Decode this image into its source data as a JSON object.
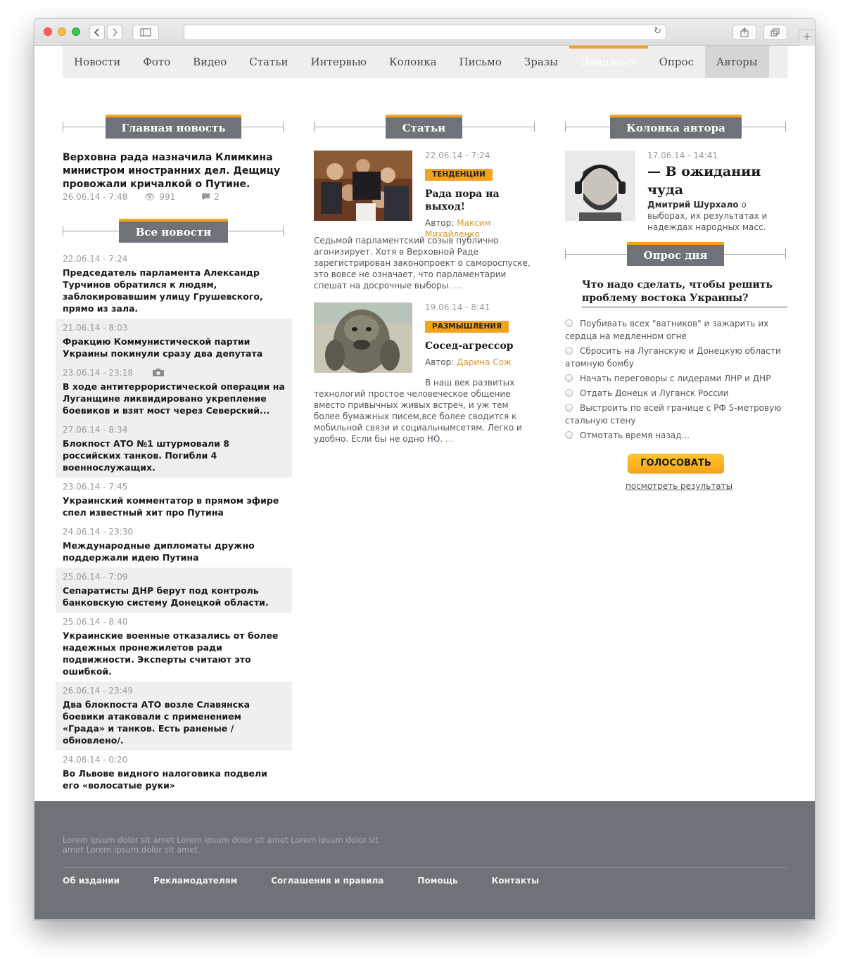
{
  "browser": {
    "back_icon": "chevron-left-icon",
    "forward_icon": "chevron-right-icon",
    "sidebar_icon": "sidebar-icon",
    "reload_icon": "reload-icon",
    "share_icon": "share-icon",
    "tabs_icon": "tabs-icon",
    "newtab_icon": "plus-icon",
    "url": ""
  },
  "nav": {
    "items": [
      "Новости",
      "Фото",
      "Видео",
      "Статьи",
      "Интервью",
      "Колонка",
      "Письмо",
      "Зразы",
      "Дайджест",
      "Опрос",
      "Авторы"
    ],
    "active": "Дайджест",
    "accent": "#f5a31a"
  },
  "main_news": {
    "header": "Главная новость",
    "title": "Верховна рада назначила Климкина министром иностранних дел. Дещицу провожали кричалкой о Путине.",
    "date": "26.06.14 - 7:48",
    "views": "991",
    "comments": "2"
  },
  "all_news": {
    "header": "Все новости",
    "items": [
      {
        "date": "22.06.14 - 7:24",
        "title": "Председатель парламента Александр Турчинов обратился к людям, заблокировавшим улицу Грушевского, прямо из зала."
      },
      {
        "date": "21.06.14 - 8:03",
        "title": "Фракцию Коммунистической партии Украины покинули сразу два депутата"
      },
      {
        "date": "23.06.14 - 23:18",
        "title": "В ходе антитеррористической операции на Луганщине ликвидировано укрепление боевиков и взят мост через Северский..."
      },
      {
        "date": "27.06.14 - 8:34",
        "title": "Блокпост АТО №1 штурмовали 8 российских танков. Погибли 4 военнослужащих."
      },
      {
        "date": "23.06.14 - 7:45",
        "title": "Украинский комментатор в прямом эфире спел известный хит про Путина"
      },
      {
        "date": "24.06.14 - 23:30",
        "title": "Международные дипломаты дружно поддержали идею Путина"
      },
      {
        "date": "25.06.14 - 7:09",
        "title": "Сепаратисты ДНР берут под контроль банковскую систему Донецкой области."
      },
      {
        "date": "25.06.14 - 8:40",
        "title": "Украинские военные отказались от более надежных пронежилетов ради подвижности. Эксперты считают это ошибкой."
      },
      {
        "date": "26.06.14 - 23:49",
        "title": "Два блокпоста АТО возле Славянска боевики атаковали с применением «Града» и танков. Есть раненые /обновлено/."
      },
      {
        "date": "24.06.14 - 0:20",
        "title": "Во Львове видного налоговика подвели его «волосатые руки»"
      }
    ]
  },
  "articles": {
    "header": "Статьи",
    "items": [
      {
        "date": "22.06.14 - 7:24",
        "tag": "ТЕНДЕНЦИИ",
        "title": "Рада пора на выход!",
        "author_label": "Автор:",
        "author": "Максим Михайленко",
        "text": "Седьмой парламентский созыв публично агонизирует. Хотя в Верховной Раде зарегистрирован законопроект о самороспуске, это вовсе не означает, что парламентарии спешат на досрочные выборы.",
        "more": "..."
      },
      {
        "date": "19.06.14 - 8:41",
        "tag": "РАЗМЫШЛЕНИЯ",
        "title": "Сосед-агрессор",
        "author_label": "Автор:",
        "author": "Дарина Сож",
        "text_intro": "В наш век развитых",
        "text": "технологий простое человеческое общение вместо привычных живых встреч, и уж тем более бумажных писем,все более сводится к мобильной связи и социальнымсетям. Легко и удобно. Если бы не одно НО.",
        "more": "..."
      }
    ]
  },
  "column": {
    "header": "Колонка автора",
    "date": "17.06.14 - 14:41",
    "title": "— В ожидании чуда",
    "author": "Дмитрий Шурхало",
    "desc": " о выборах, их результатах и надеждах народных масс."
  },
  "poll": {
    "header": "Опрос дня",
    "question": "Что надо сделать, чтобы решить проблему востока Украины?",
    "options": [
      "Поубивать всех \"ватников\" и зажарить их сердца на медленном огне",
      "Сбросить на Луганскую и Донецкую области атомную бомбу",
      "Начать переговоры с лидерами ЛНР и ДНР",
      "Отдать Донецк и Луганск России",
      "Выстроить по всей границе с РФ 5-метровую стальную стену",
      "Отмотать время назад..."
    ],
    "vote_button": "ГОЛОСОВАТЬ",
    "results_link": "посмотреть результаты"
  },
  "footer": {
    "text": "Lorem ipsum dolor sit amet Lorem ipsum dolor sit amet Lorem ipsum dolor sit amet Lorem ipsum dolor sit amet.",
    "links": [
      "Об издании",
      "Рекламодателям",
      "Соглашения и правила",
      "Помощь",
      "Контакты"
    ]
  }
}
